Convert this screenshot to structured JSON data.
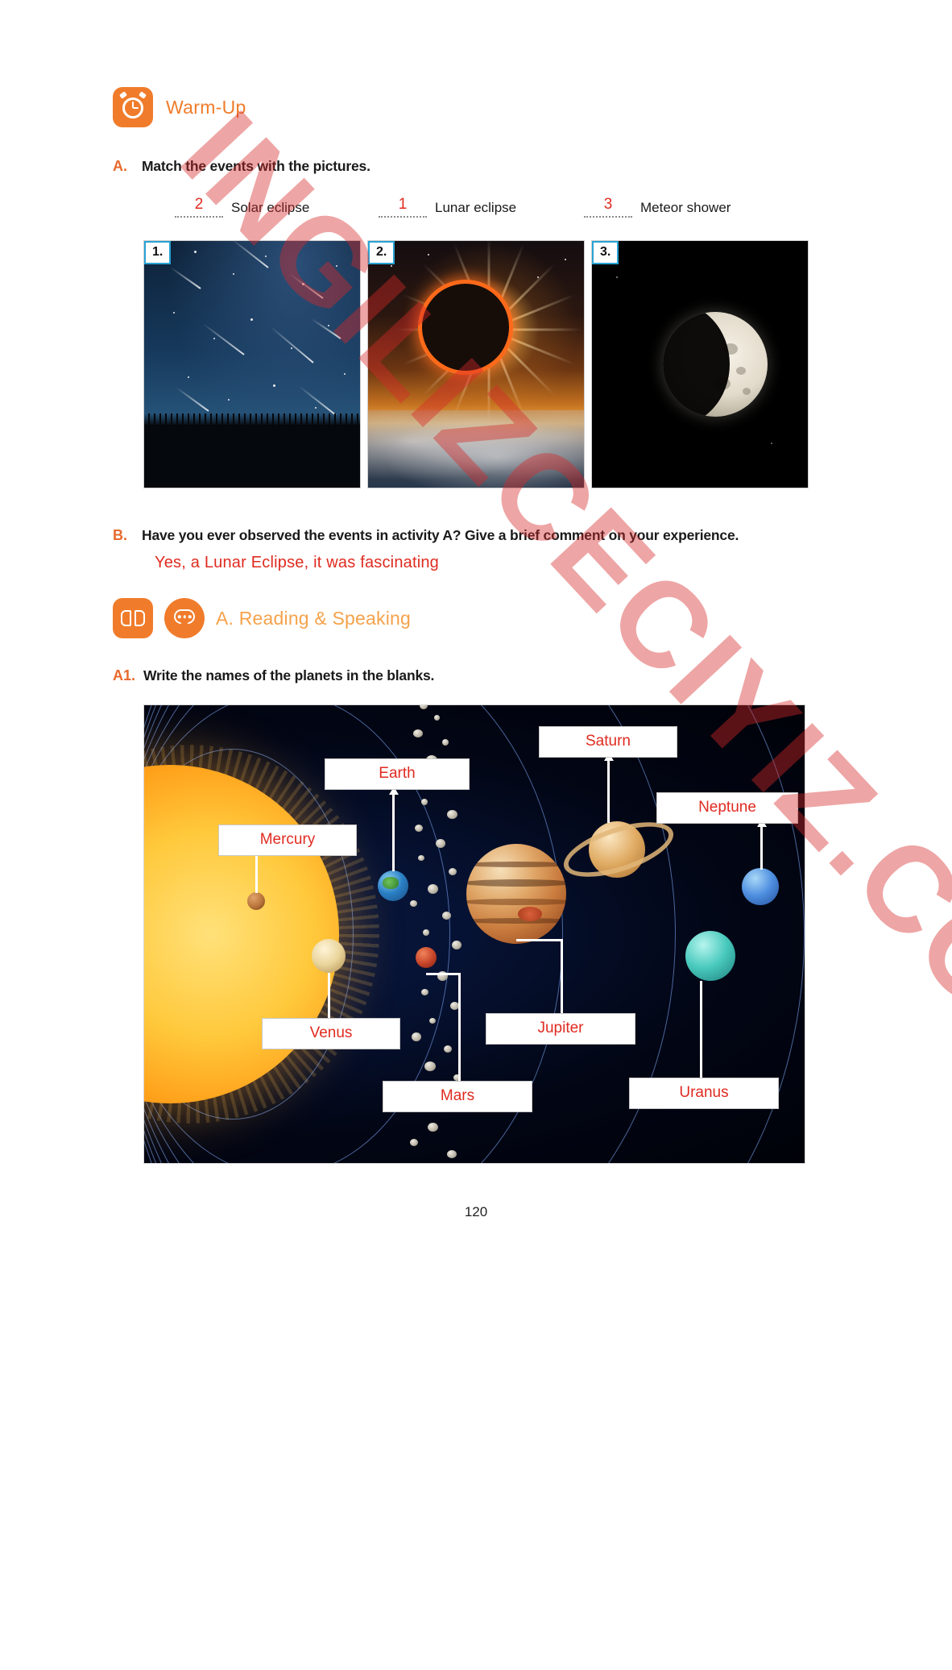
{
  "warmup": {
    "title": "Warm-Up",
    "icon": "alarm-clock-icon"
  },
  "exercise_a": {
    "letter": "A.",
    "instruction": "Match the events with the pictures.",
    "matches": [
      {
        "answer": "2",
        "label": "Solar eclipse"
      },
      {
        "answer": "1",
        "label": "Lunar eclipse"
      },
      {
        "answer": "3",
        "label": "Meteor shower"
      }
    ],
    "pictures": [
      {
        "number": "1.",
        "caption": "meteor-shower-photo"
      },
      {
        "number": "2.",
        "caption": "solar-eclipse-photo"
      },
      {
        "number": "3.",
        "caption": "lunar-eclipse-photo"
      }
    ]
  },
  "exercise_b": {
    "letter": "B.",
    "instruction": "Have you ever observed the events in activity A? Give a brief comment on your experience.",
    "answer": "Yes, a Lunar Eclipse, it was  fascinating"
  },
  "reading_speaking": {
    "title": "A. Reading & Speaking",
    "icons": [
      "open-book-icon",
      "speech-bubble-icon"
    ]
  },
  "exercise_a1": {
    "letter": "A1.",
    "instruction": "Write the names of the planets in the blanks.",
    "planet_labels": [
      {
        "name": "Mercury"
      },
      {
        "name": "Venus"
      },
      {
        "name": "Earth"
      },
      {
        "name": "Mars"
      },
      {
        "name": "Jupiter"
      },
      {
        "name": "Saturn"
      },
      {
        "name": "Uranus"
      },
      {
        "name": "Neptune"
      }
    ]
  },
  "footer": {
    "page_number": "120"
  },
  "watermark": {
    "text": "INGILIZCECIYIZ.COM"
  },
  "colors": {
    "accent_orange": "#f07c2b",
    "letter_orange": "#e8692c",
    "answer_red": "#e02b20",
    "title_orange": "#f5a24b",
    "pic_border_blue": "#29a3d4"
  }
}
